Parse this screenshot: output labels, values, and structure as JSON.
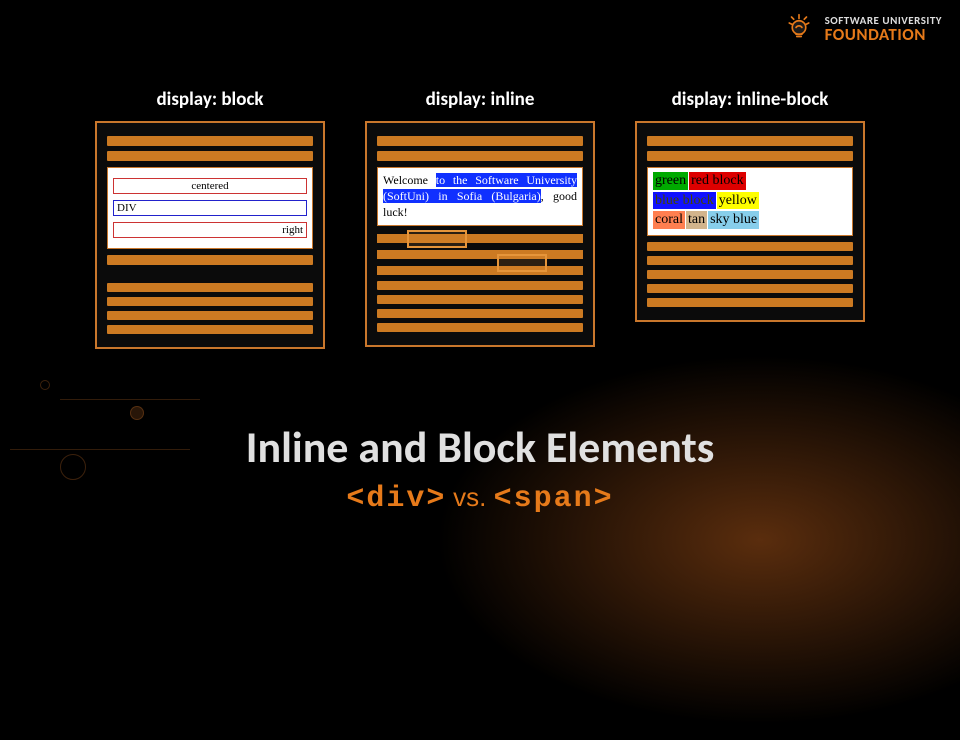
{
  "logo": {
    "top": "SOFTWARE UNIVERSITY",
    "bottom": "FOUNDATION"
  },
  "columns": {
    "block": {
      "heading": "display: block",
      "rows": {
        "centered": "centered",
        "div": "DIV",
        "right": "right"
      }
    },
    "inline": {
      "heading": "display: inline",
      "t1": "Welcome ",
      "t2": "to the Software University (SoftUni) in Sofia (Bulgaria)",
      "t3": ", good luck!"
    },
    "inlineblock": {
      "heading": "display: inline-block",
      "cells": {
        "green": "green",
        "red": "red block",
        "blue": "blue block",
        "yellow": "yellow",
        "coral": "coral",
        "tan": "tan",
        "sky": "sky blue"
      }
    }
  },
  "title": "Inline and Block Elements",
  "subtitle": {
    "div": "<div>",
    "vs": " vs. ",
    "span": "<span>"
  }
}
